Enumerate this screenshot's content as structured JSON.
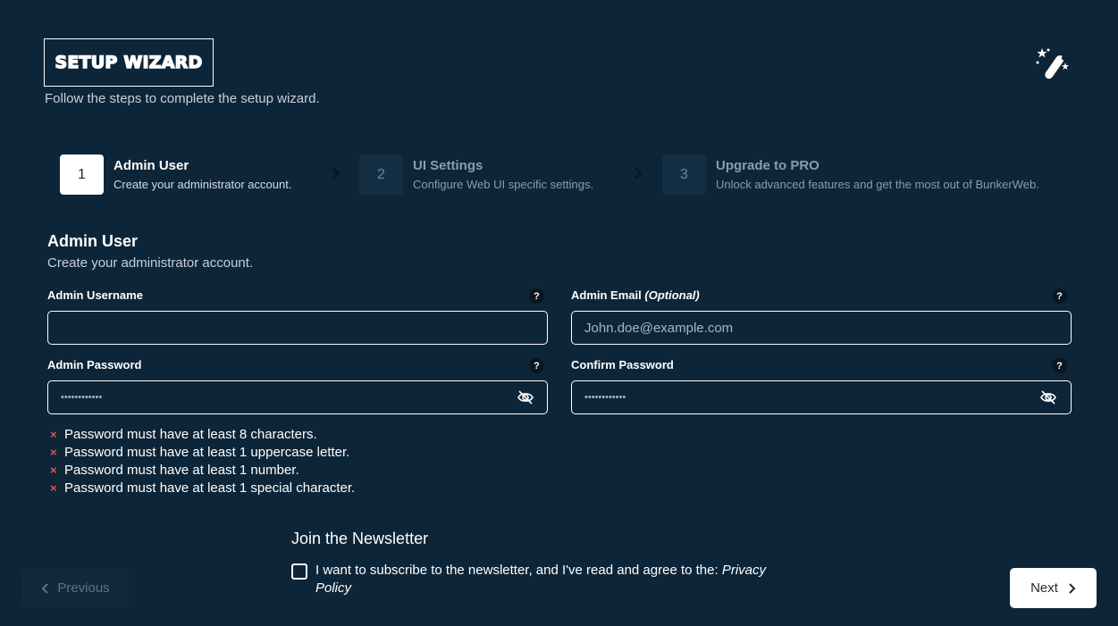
{
  "header": {
    "title": "SETUP WIZARD",
    "subtitle": "Follow the steps to complete the setup wizard.",
    "icon": "magic-wand-icon"
  },
  "steps": [
    {
      "number": "1",
      "title": "Admin User",
      "description": "Create your administrator account.",
      "state": "active"
    },
    {
      "number": "2",
      "title": "UI Settings",
      "description": "Configure Web UI specific settings.",
      "state": "inactive"
    },
    {
      "number": "3",
      "title": "Upgrade to PRO",
      "description": "Unlock advanced features and get the most out of BunkerWeb.",
      "state": "inactive"
    }
  ],
  "section": {
    "title": "Admin User",
    "description": "Create your administrator account."
  },
  "form": {
    "username": {
      "label": "Admin Username",
      "value": "",
      "placeholder": "",
      "help": "?"
    },
    "email": {
      "label": "Admin Email",
      "optional": "(Optional)",
      "value": "",
      "placeholder": "John.doe@example.com",
      "help": "?"
    },
    "password": {
      "label": "Admin Password",
      "placeholder": "••••••••••••",
      "help": "?"
    },
    "confirm": {
      "label": "Confirm Password",
      "placeholder": "••••••••••••",
      "help": "?"
    }
  },
  "password_rules": [
    {
      "mark": "×",
      "text": "Password must have at least 8 characters."
    },
    {
      "mark": "×",
      "text": "Password must have at least 1 uppercase letter."
    },
    {
      "mark": "×",
      "text": "Password must have at least 1 number."
    },
    {
      "mark": "×",
      "text": "Password must have at least 1 special character."
    }
  ],
  "newsletter": {
    "title": "Join the Newsletter",
    "text": "I want to subscribe to the newsletter, and I've read and agree to the: ",
    "link": "Privacy Policy",
    "checked": false
  },
  "nav": {
    "previous": "Previous",
    "next": "Next"
  },
  "colors": {
    "background": "#0d2538",
    "error": "#e35454"
  }
}
